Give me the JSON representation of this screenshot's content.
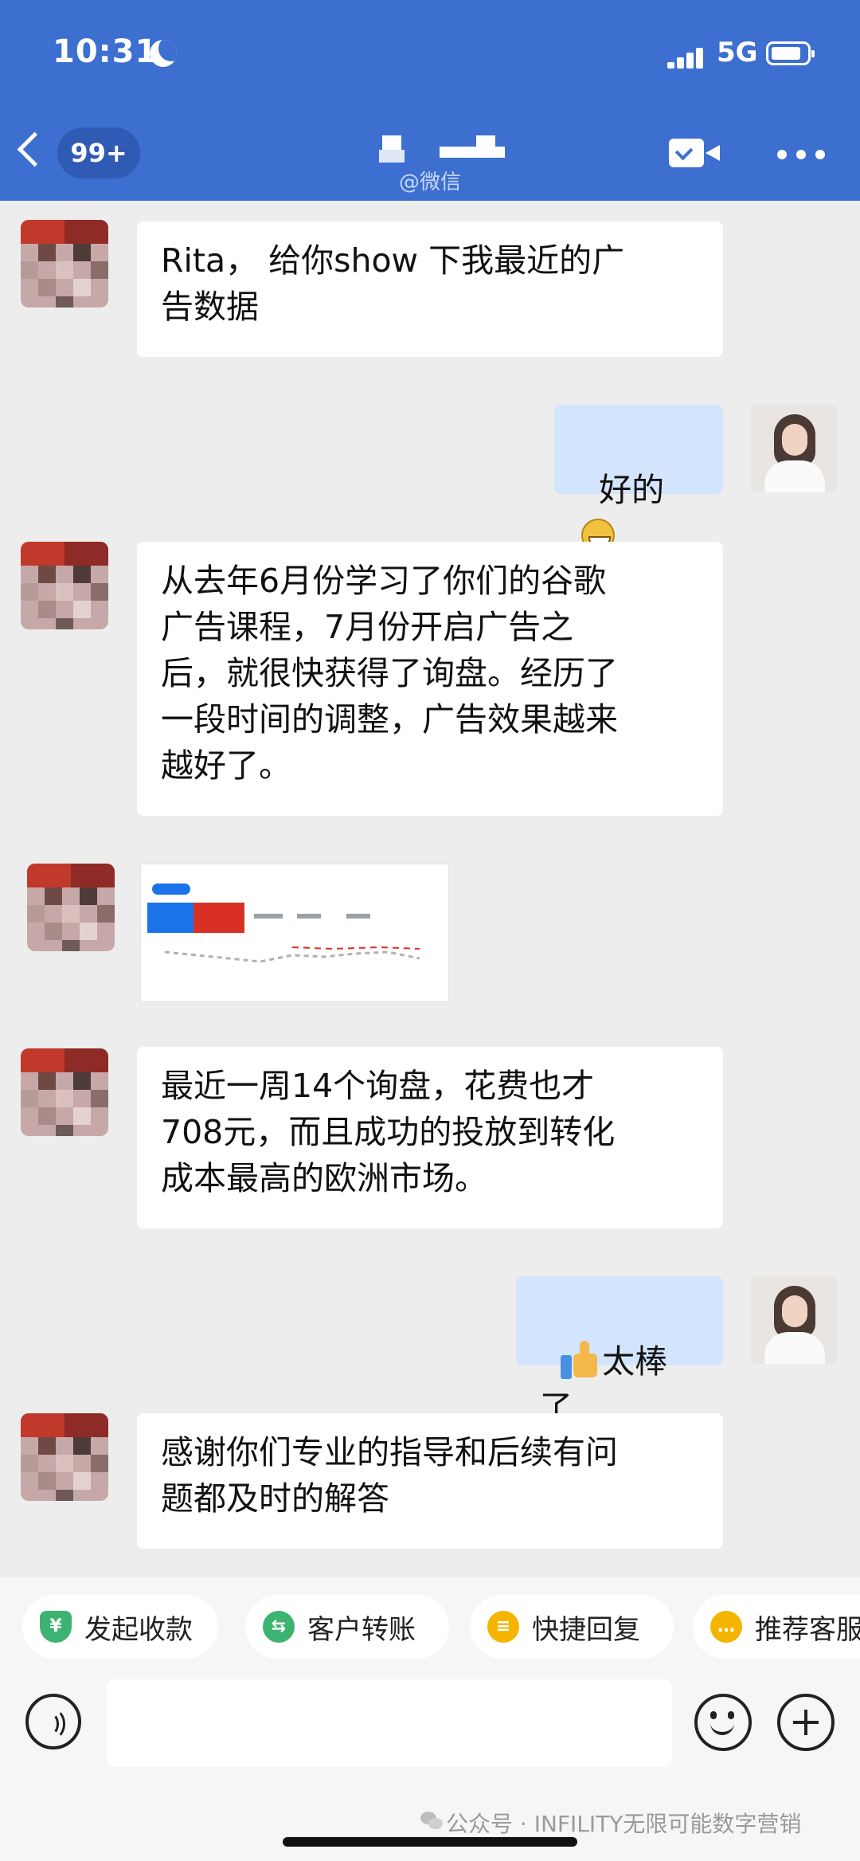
{
  "status_bar": {
    "time": "10:31",
    "network": "5G"
  },
  "header": {
    "unread_count": "99+",
    "subtitle": "@微信"
  },
  "messages": [
    {
      "side": "in",
      "text": "Rita， 给你show 下我最近的广\n告数据"
    },
    {
      "side": "out",
      "text": "好的",
      "emoji": "grinning-face"
    },
    {
      "side": "in",
      "text": "从去年6月份学习了你们的谷歌\n广告课程，7月份开启广告之\n后，就很快获得了询盘。经历了\n一段时间的调整，广告效果越来\n越好了。"
    },
    {
      "side": "in",
      "type": "image",
      "content": "ads-dashboard-screenshot"
    },
    {
      "side": "in",
      "text": "最近一周14个询盘，花费也才\n708元，而且成功的投放到转化\n成本最高的欧洲市场。"
    },
    {
      "side": "out",
      "text": "太棒了",
      "emoji": "thumbs-up"
    },
    {
      "side": "in",
      "text": "感谢你们专业的指导和后续有问\n题都及时的解答"
    }
  ],
  "quick_actions": [
    {
      "label": "发起收款",
      "icon": "yen-shield-icon",
      "color": "#3cb371"
    },
    {
      "label": "客户转账",
      "icon": "transfer-icon",
      "color": "#3cb371"
    },
    {
      "label": "快捷回复",
      "icon": "quick-reply-icon",
      "color": "#f5b400"
    },
    {
      "label": "推荐客服",
      "icon": "recommend-icon",
      "color": "#f5b400"
    }
  ],
  "watermark": "公众号 · INFILITY无限可能数字营销",
  "colors": {
    "header": "#3d6fd1",
    "outgoing_bubble": "#d3e5fd",
    "incoming_bubble": "#ffffff",
    "background": "#ededed"
  }
}
